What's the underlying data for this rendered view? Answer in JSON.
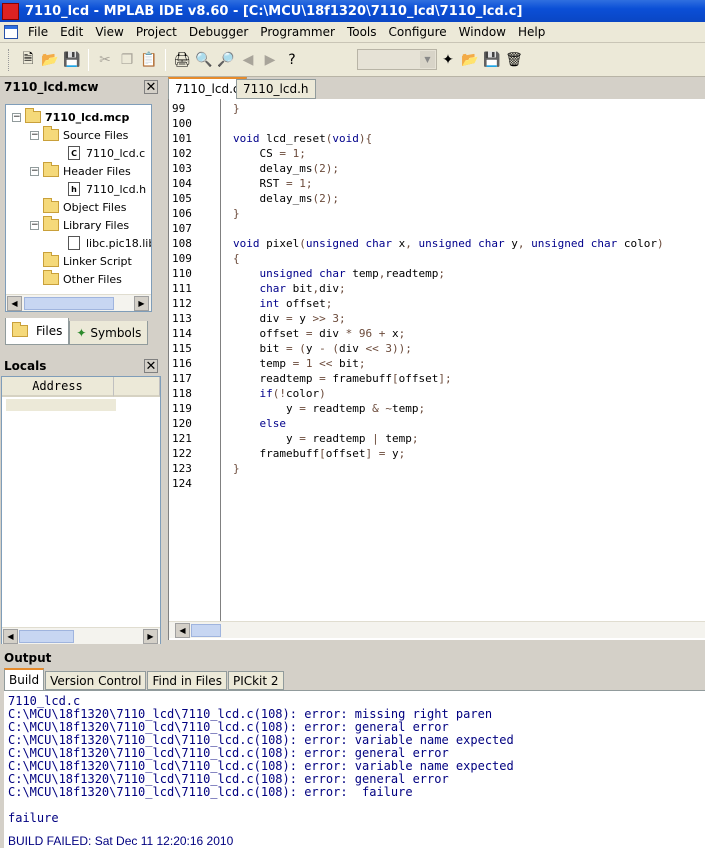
{
  "window": {
    "title": "7110_lcd - MPLAB IDE v8.60 - [C:\\MCU\\18f1320\\7110_lcd\\7110_lcd.c]",
    "logo_text": "MPLAB"
  },
  "menu": [
    "File",
    "Edit",
    "View",
    "Project",
    "Debugger",
    "Programmer",
    "Tools",
    "Configure",
    "Window",
    "Help"
  ],
  "toolbar": {
    "buttons": [
      "new-file",
      "open",
      "save",
      "cut",
      "copy",
      "paste",
      "print",
      "find",
      "find-next",
      "back",
      "forward",
      "help"
    ],
    "combo_value": ""
  },
  "workspace": {
    "title": "7110_lcd.mcw",
    "project": "7110_lcd.mcp",
    "tree": [
      {
        "label": "Source Files",
        "type": "folder"
      },
      {
        "label": "7110_lcd.c",
        "type": "file",
        "glyph": "C"
      },
      {
        "label": "Header Files",
        "type": "folder"
      },
      {
        "label": "7110_lcd.h",
        "type": "file",
        "glyph": "h"
      },
      {
        "label": "Object Files",
        "type": "folder"
      },
      {
        "label": "Library Files",
        "type": "folder"
      },
      {
        "label": "libc.pic18.lib",
        "type": "file",
        "glyph": ""
      },
      {
        "label": "Linker Script",
        "type": "folder"
      },
      {
        "label": "Other Files",
        "type": "folder"
      }
    ],
    "tabs": [
      "Files",
      "Symbols"
    ]
  },
  "locals": {
    "title": "Locals",
    "column": "Address"
  },
  "editor": {
    "tabs": [
      "7110_lcd.c",
      "7110_lcd.h"
    ],
    "lines": [
      {
        "num": "99",
        "text": "}"
      },
      {
        "num": "100",
        "text": ""
      },
      {
        "num": "101",
        "text": "void lcd_reset(void){"
      },
      {
        "num": "102",
        "text": "    CS = 1;"
      },
      {
        "num": "103",
        "text": "    delay_ms(2);"
      },
      {
        "num": "104",
        "text": "    RST = 1;"
      },
      {
        "num": "105",
        "text": "    delay_ms(2);"
      },
      {
        "num": "106",
        "text": "}"
      },
      {
        "num": "107",
        "text": ""
      },
      {
        "num": "108",
        "text": "void pixel(unsigned char x, unsigned char y, unsigned char color)"
      },
      {
        "num": "109",
        "text": "{"
      },
      {
        "num": "110",
        "text": "    unsigned char temp,readtemp;"
      },
      {
        "num": "111",
        "text": "    char bit,div;"
      },
      {
        "num": "112",
        "text": "    int offset;"
      },
      {
        "num": "113",
        "text": "    div = y >> 3;"
      },
      {
        "num": "114",
        "text": "    offset = div * 96 + x;"
      },
      {
        "num": "115",
        "text": "    bit = (y - (div << 3));"
      },
      {
        "num": "116",
        "text": "    temp = 1 << bit;"
      },
      {
        "num": "117",
        "text": "    readtemp = framebuff[offset];"
      },
      {
        "num": "118",
        "text": "    if(!color)"
      },
      {
        "num": "119",
        "text": "        y = readtemp & ~temp;"
      },
      {
        "num": "120",
        "text": "    else"
      },
      {
        "num": "121",
        "text": "        y = readtemp | temp;"
      },
      {
        "num": "122",
        "text": "    framebuff[offset] = y;"
      },
      {
        "num": "123",
        "text": "}"
      },
      {
        "num": "124",
        "text": ""
      }
    ]
  },
  "output": {
    "title": "Output",
    "tabs": [
      "Build",
      "Version Control",
      "Find in Files",
      "PICkit 2"
    ],
    "lines": [
      "7110_lcd.c",
      "C:\\MCU\\18f1320\\7110_lcd\\7110_lcd.c(108): error: missing right paren",
      "C:\\MCU\\18f1320\\7110_lcd\\7110_lcd.c(108): error: general error",
      "C:\\MCU\\18f1320\\7110_lcd\\7110_lcd.c(108): error: variable name expected",
      "C:\\MCU\\18f1320\\7110_lcd\\7110_lcd.c(108): error: general error",
      "C:\\MCU\\18f1320\\7110_lcd\\7110_lcd.c(108): error: variable name expected",
      "C:\\MCU\\18f1320\\7110_lcd\\7110_lcd.c(108): error: general error",
      "C:\\MCU\\18f1320\\7110_lcd\\7110_lcd.c(108): error:  failure",
      "",
      "failure"
    ],
    "status": "BUILD FAILED: Sat Dec 11 12:20:16 2010"
  },
  "colors": {
    "keyword": "#00008b",
    "text": "#000000",
    "punct": "#6b4a3a",
    "output": "#000080",
    "title_blue": "#0b4fd6"
  }
}
